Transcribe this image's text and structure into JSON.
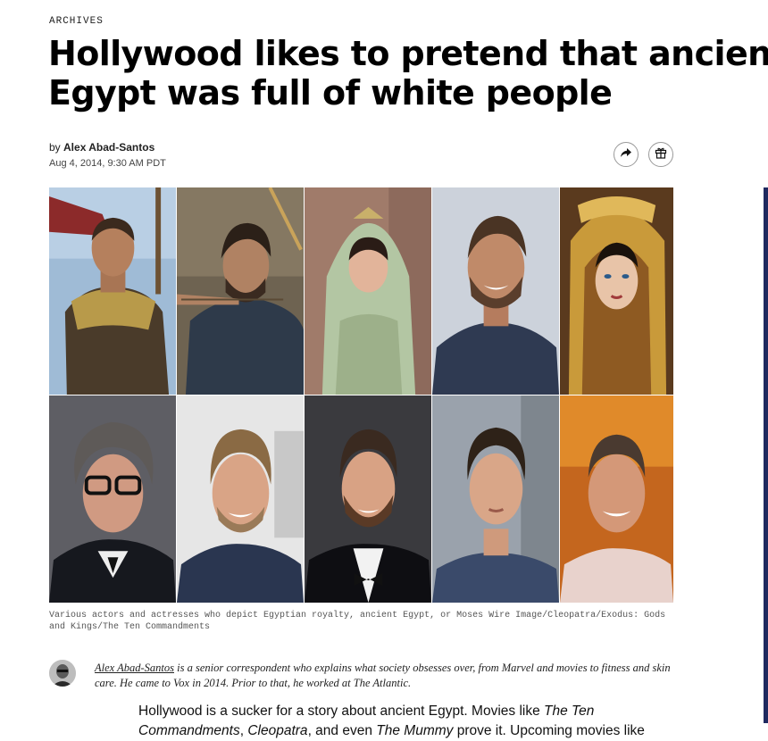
{
  "article": {
    "kicker": "ARCHIVES",
    "headline_line1": "Hollywood likes to pretend that ancient",
    "headline_line2": "Egypt was full of white people",
    "byline_prefix": "by ",
    "author": "Alex Abad-Santos",
    "date": "Aug 4, 2014, 9:30 AM PDT",
    "share_icon": "share-arrow-icon",
    "gift_icon": "gift-icon"
  },
  "image": {
    "caption": "Various actors and actresses who depict Egyptian royalty, ancient Egypt, or Moses Wire Image/Cleopatra/Exodus: Gods and Kings/The Ten Commandments"
  },
  "author_box": {
    "name": "Alex Abad-Santos",
    "bio": " is a senior correspondent who explains what society obsesses over, from Marvel and movies to fitness and skin care. He came to Vox in 2014. Prior to that, he worked at The Atlantic."
  },
  "body": {
    "p1_a": "Hollywood is a sucker for a story about ancient Egypt. Movies like ",
    "p1_b": "The Ten Commandments",
    "p1_c": ", ",
    "p1_d": "Cleopatra",
    "p1_e": ", and even ",
    "p1_f": "The Mummy",
    "p1_g": " prove it. Upcoming movies like"
  }
}
